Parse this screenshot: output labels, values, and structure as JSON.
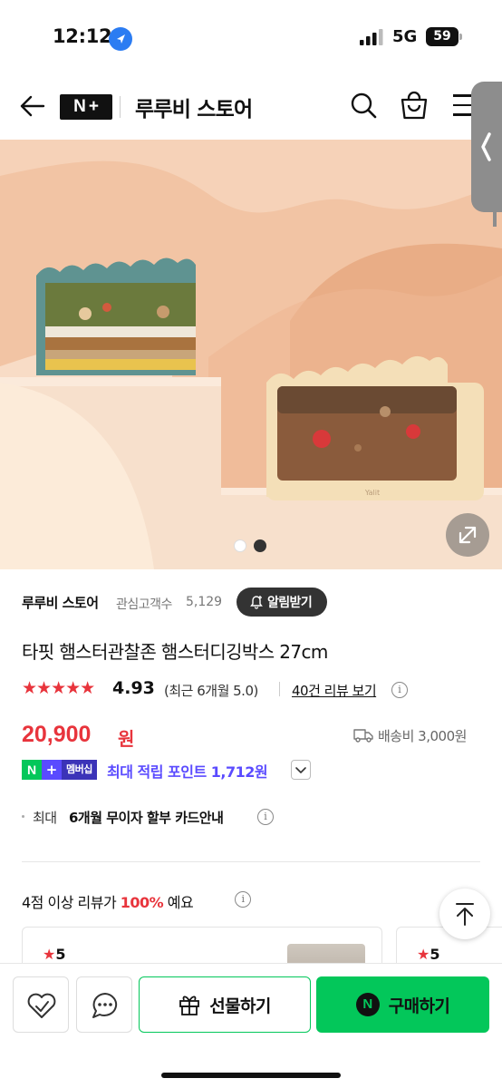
{
  "status_bar": {
    "time": "12:12",
    "network": "5G",
    "battery": "59"
  },
  "header": {
    "logo_n": "N",
    "logo_plus": "+",
    "store_title": "루루비 스토어"
  },
  "product": {
    "store_name": "루루비 스토어",
    "follower_label": "관심고객수",
    "follower_count": "5,129",
    "alert_button": "알림받기",
    "title": "타핏 햄스터관찰존 햄스터디깅박스 27cm",
    "stars": "★★★★★",
    "rating": "4.93",
    "recent_rating": "(최근 6개월 5.0)",
    "review_link": "40건 리뷰 보기",
    "price": "20,900",
    "price_unit": "원",
    "shipping": "배송비 3,000원",
    "membership_n": "N",
    "membership_plus": "+",
    "membership_label": "멤버십",
    "membership_points": "최대 적립 포인트 1,712원",
    "card_label": "최대",
    "card_highlight": "6개월 무이자 할부 카드안내",
    "review_summary_prefix": "4점 이상 리뷰가",
    "review_summary_pct": "100%",
    "review_summary_suffix": "예요"
  },
  "image_brand": "Yalit",
  "carousel": {
    "total": 2,
    "active_index": 1
  },
  "reviews": [
    {
      "stars": "★",
      "score": "5"
    },
    {
      "stars": "★",
      "score": "5"
    }
  ],
  "bottom_bar": {
    "gift_label": "선물하기",
    "buy_label": "구매하기",
    "buy_n": "N"
  },
  "colors": {
    "accent_red": "#e8343c",
    "naver_green": "#03c75a",
    "membership_purple": "#5a4bff"
  },
  "icons": [
    "location-arrow-icon",
    "signal-icon",
    "battery-icon",
    "back-arrow-icon",
    "search-icon",
    "shopping-bag-icon",
    "menu-icon",
    "expand-icon",
    "bell-icon",
    "info-icon",
    "truck-icon",
    "chevron-down-icon",
    "arrow-up-icon",
    "heart-check-icon",
    "chat-icon",
    "gift-icon"
  ]
}
